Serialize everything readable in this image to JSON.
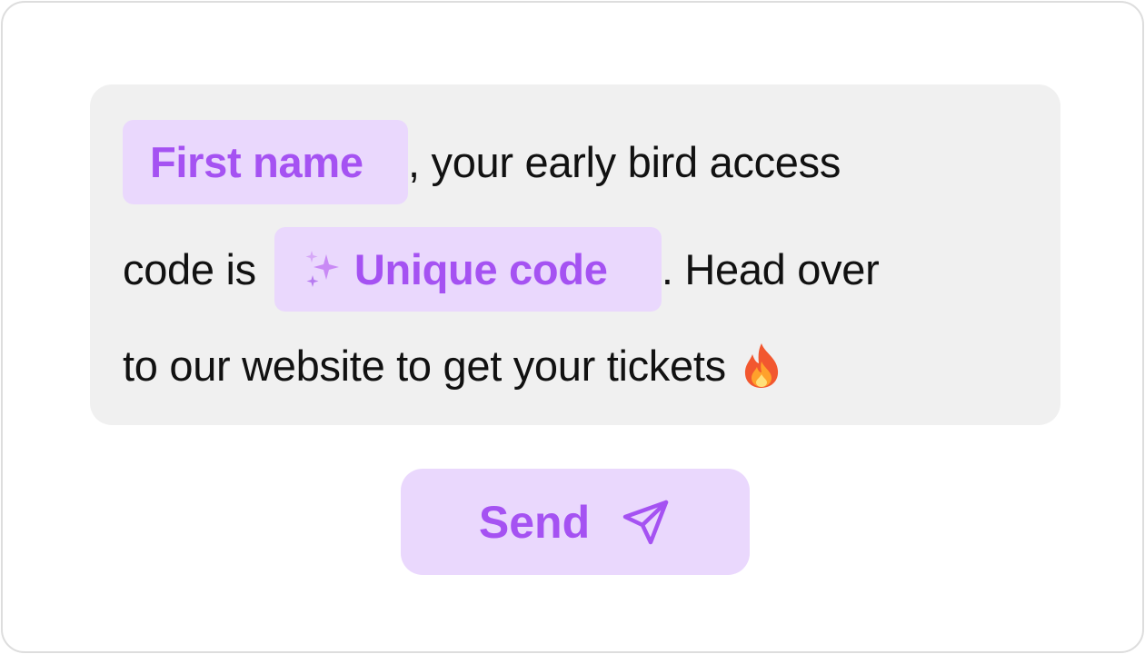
{
  "message": {
    "first_name_token": "First name",
    "line1_text": ", your early bird access",
    "line2_prefix": "code is",
    "unique_code_token": "Unique code",
    "line2_suffix": ". Head over",
    "line3_text": "to our website to get your tickets"
  },
  "icons": {
    "sparkle": "sparkles-icon",
    "emoji": "fire-emoji",
    "send": "paper-plane-icon"
  },
  "send_button": {
    "label": "Send"
  },
  "colors": {
    "accent": "#a552f2",
    "chip_background": "#ead8fd",
    "message_background": "#f0f0f0",
    "border": "#dddddd"
  }
}
